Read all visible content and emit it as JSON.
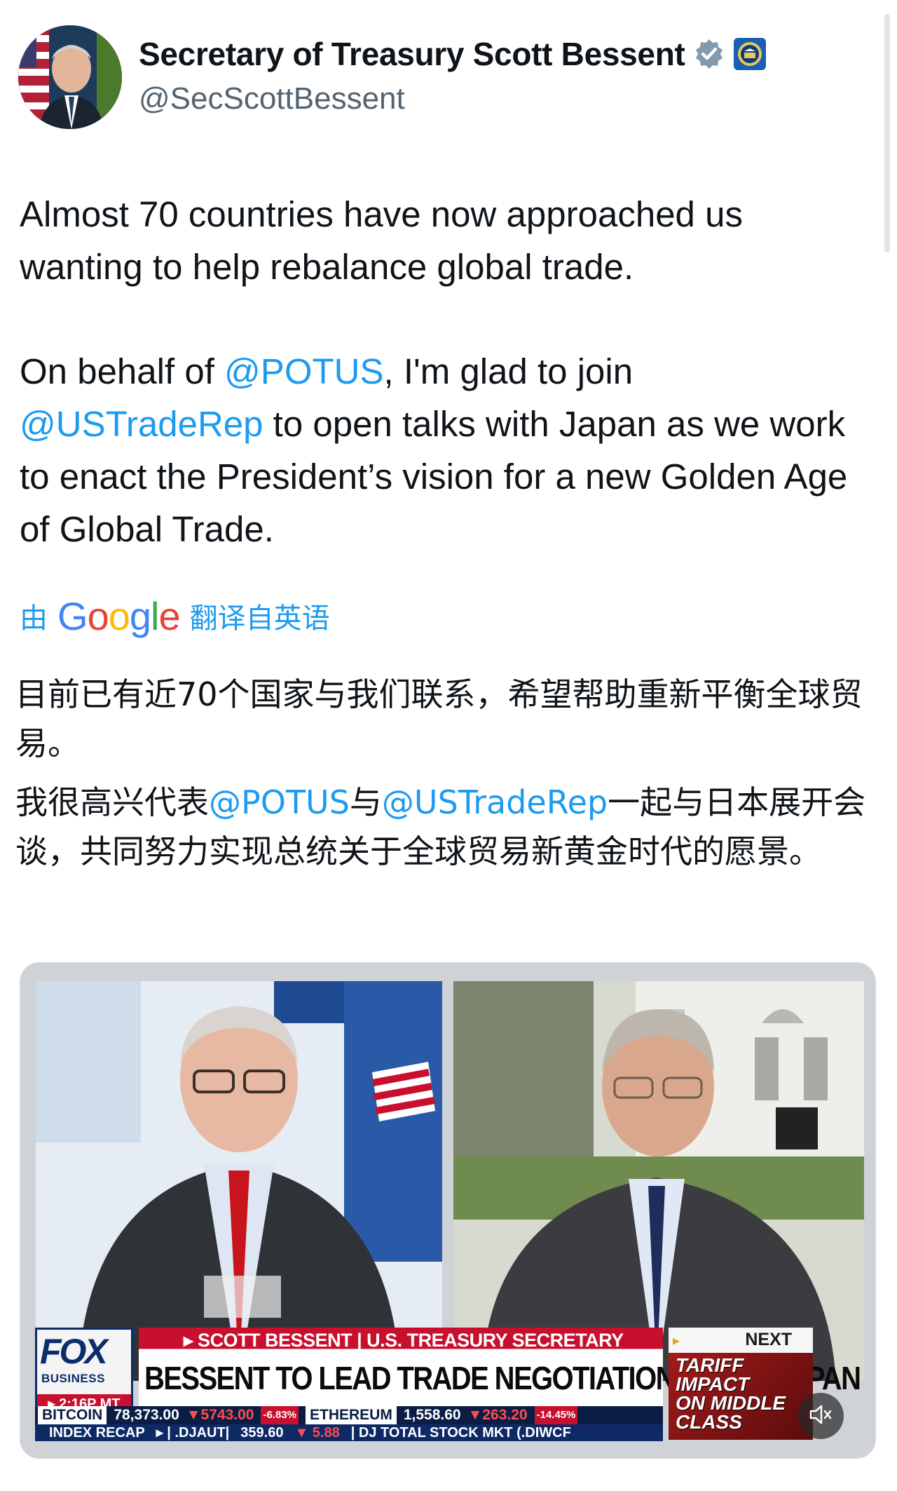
{
  "author": {
    "name": "Secretary of Treasury Scott Bessent",
    "handle": "@SecScottBessent"
  },
  "tweet": {
    "paragraph1": "Almost 70 countries have now approached us wanting to help rebalance global trade.",
    "p2_part1": "On behalf of ",
    "mention1": "@POTUS",
    "p2_part2": ", I'm glad to join",
    "mention2": "@USTradeRep",
    "p2_part3": " to open talks with Japan as we work to enact the President’s vision for a new Golden Age of Global Trade."
  },
  "translation": {
    "by_label": "由",
    "google_logo": [
      "G",
      "o",
      "o",
      "g",
      "l",
      "e"
    ],
    "source_label": "翻译自英语",
    "paragraph1": "目前已有近70个国家与我们联系，希望帮助重新平衡全球贸易。",
    "p2_part1": "我很高兴代表",
    "mention1": "@POTUS",
    "p2_part2": "与",
    "mention2": "@USTradeRep",
    "p2_part3": "一起与日本展开会谈，共同努力实现总统关于全球贸易新黄金时代的愿景。"
  },
  "video": {
    "logo_text": "FOX",
    "logo_sub": "BUSINESS",
    "time": "▸ 2:16P MT",
    "name_strap": "▸ SCOTT BESSENT | U.S. TREASURY SECRETARY",
    "headline": "BESSENT TO LEAD TRADE NEGOTIATIONS WITH JAPAN",
    "next_label": "NEXT",
    "next_title": "TARIFF\nIMPACT\nON MIDDLE\nCLASS",
    "ticker": {
      "bitcoin_label": "BITCOIN",
      "bitcoin_value": "78,373.00",
      "bitcoin_change": "▼5743.00",
      "bitcoin_pct": "-6.83%",
      "eth_label": "ETHEREUM",
      "eth_value": "1,558.60",
      "eth_change": "▼263.20",
      "eth_pct": "-14.45%"
    },
    "recap": {
      "label": "INDEX RECAP",
      "djaut": "▸ | .DJAUT|",
      "djaut_value": "359.60",
      "djaut_change": "▼ 5.88",
      "total": "| DJ TOTAL STOCK MKT (.DIWCF"
    }
  },
  "colors": {
    "link": "#1d9bf0",
    "text": "#0f1419",
    "secondary": "#536471",
    "fox_red": "#c8102e",
    "fox_navy": "#0b1d45"
  },
  "icons": {
    "verified": "verified-badge-icon",
    "seal": "treasury-seal-icon",
    "mute": "speaker-muted-icon"
  }
}
